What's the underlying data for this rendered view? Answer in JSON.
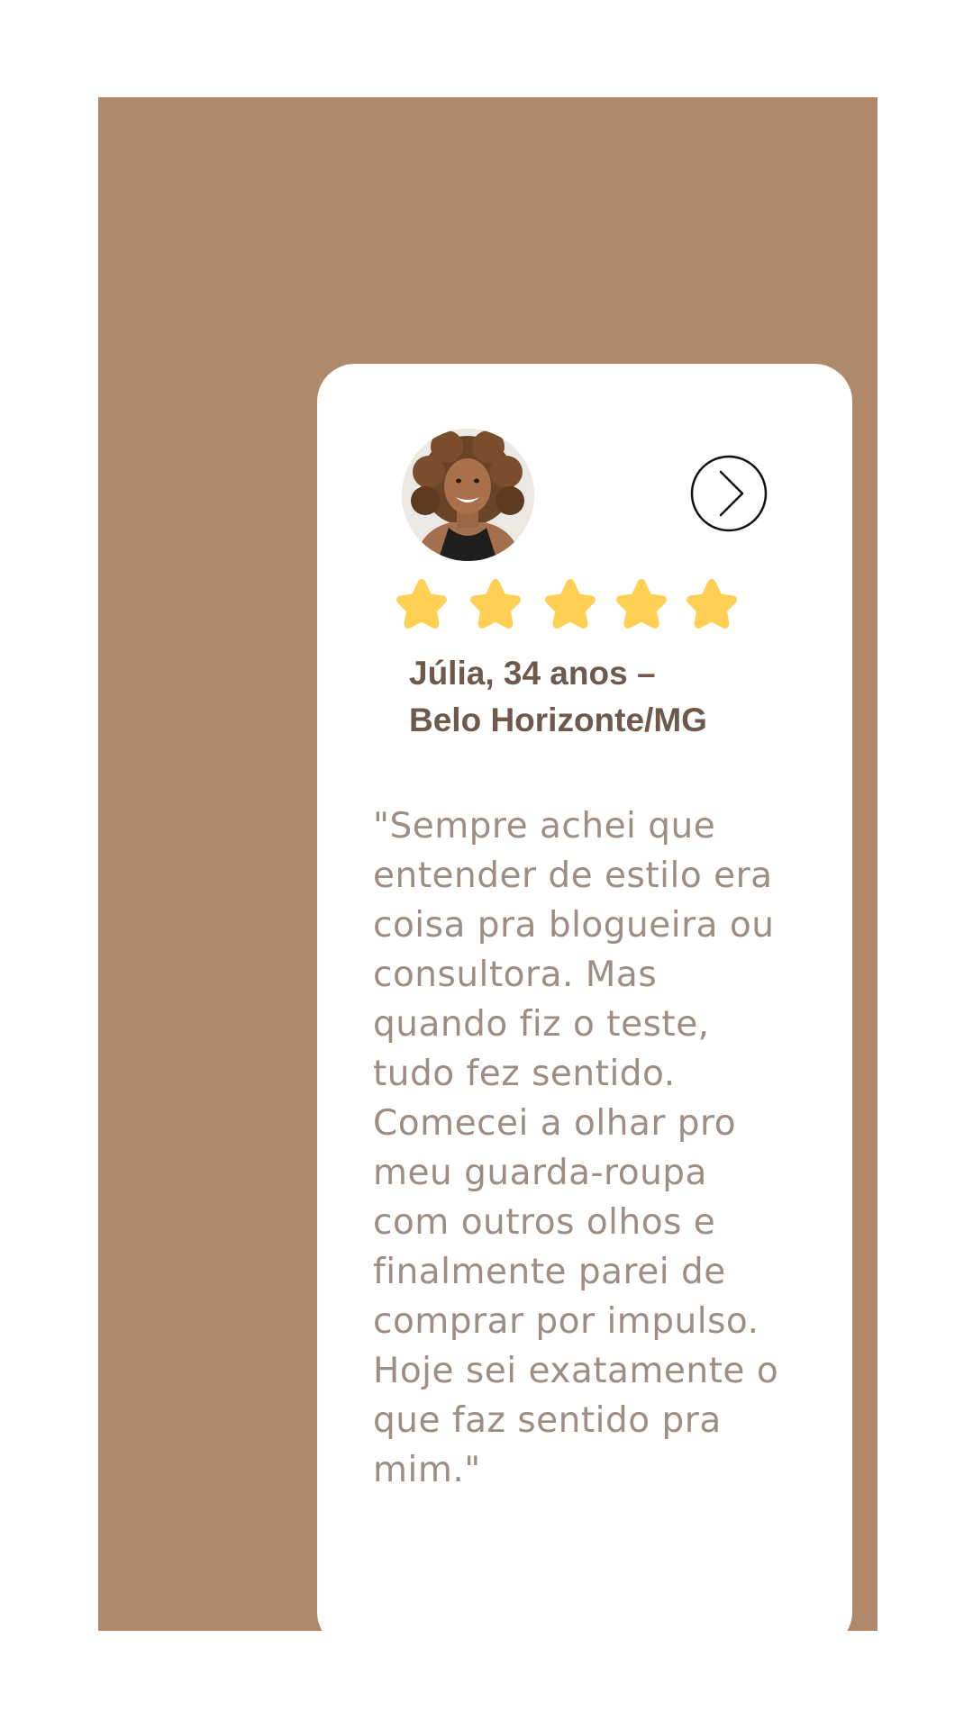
{
  "testimonial": {
    "colors": {
      "frame": "#b0896a",
      "card": "#ffffff",
      "star": "#ffd054",
      "name": "#6d5a4d",
      "quote": "#9d8d82"
    },
    "avatar_icon": "woman-portrait-photo",
    "next_icon": "chevron-right-circle-icon",
    "rating": 5,
    "rating_max": 5,
    "reviewer": {
      "line1": "Júlia, 34 anos –",
      "line2": "Belo Horizonte/MG"
    },
    "quote_lines": [
      "\"Sempre achei que",
      "entender de estilo era",
      "coisa pra blogueira ou",
      "consultora. Mas",
      "quando fiz o teste,",
      "tudo fez sentido.",
      "Comecei a olhar pro",
      "meu guarda-roupa",
      "com outros olhos e",
      "finalmente parei de",
      "comprar por impulso.",
      "Hoje sei exatamente o",
      "que faz sentido pra",
      "mim.\""
    ]
  }
}
